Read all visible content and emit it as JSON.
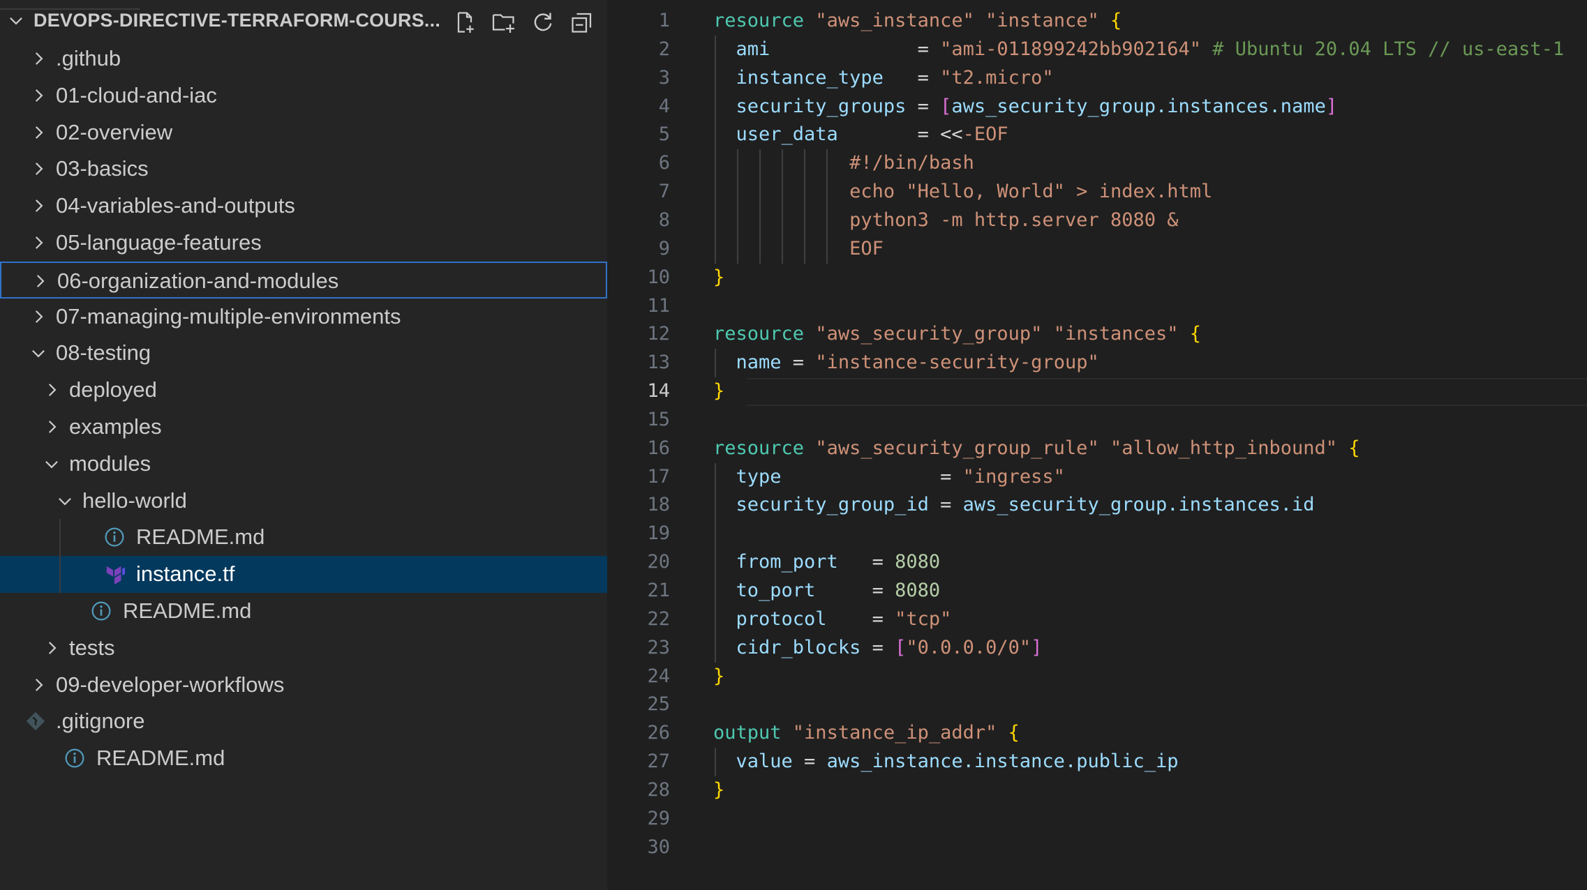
{
  "explorer": {
    "title": "DEVOPS-DIRECTIVE-TERRAFORM-COURS...",
    "actions": [
      {
        "name": "new-file",
        "icon": "new-file-icon"
      },
      {
        "name": "new-folder",
        "icon": "new-folder-icon"
      },
      {
        "name": "refresh",
        "icon": "refresh-icon"
      },
      {
        "name": "collapse-all",
        "icon": "collapse-all-icon"
      }
    ],
    "items": [
      {
        "label": ".github",
        "depth": 0,
        "kind": "folder",
        "expanded": false
      },
      {
        "label": "01-cloud-and-iac",
        "depth": 0,
        "kind": "folder",
        "expanded": false
      },
      {
        "label": "02-overview",
        "depth": 0,
        "kind": "folder",
        "expanded": false
      },
      {
        "label": "03-basics",
        "depth": 0,
        "kind": "folder",
        "expanded": false
      },
      {
        "label": "04-variables-and-outputs",
        "depth": 0,
        "kind": "folder",
        "expanded": false
      },
      {
        "label": "05-language-features",
        "depth": 0,
        "kind": "folder",
        "expanded": false
      },
      {
        "label": "06-organization-and-modules",
        "depth": 0,
        "kind": "folder",
        "expanded": false,
        "state": "focused"
      },
      {
        "label": "07-managing-multiple-environments",
        "depth": 0,
        "kind": "folder",
        "expanded": false
      },
      {
        "label": "08-testing",
        "depth": 0,
        "kind": "folder",
        "expanded": true
      },
      {
        "label": "deployed",
        "depth": 1,
        "kind": "folder",
        "expanded": false
      },
      {
        "label": "examples",
        "depth": 1,
        "kind": "folder",
        "expanded": false
      },
      {
        "label": "modules",
        "depth": 1,
        "kind": "folder",
        "expanded": true
      },
      {
        "label": "hello-world",
        "depth": 2,
        "kind": "folder",
        "expanded": true
      },
      {
        "label": "README.md",
        "depth": 3,
        "kind": "info-file"
      },
      {
        "label": "instance.tf",
        "depth": 3,
        "kind": "terraform-file",
        "state": "selected"
      },
      {
        "label": "README.md",
        "depth": 2,
        "kind": "info-file"
      },
      {
        "label": "tests",
        "depth": 1,
        "kind": "folder",
        "expanded": false
      },
      {
        "label": "09-developer-workflows",
        "depth": 0,
        "kind": "folder",
        "expanded": false
      },
      {
        "label": ".gitignore",
        "depth": 0,
        "kind": "git-file"
      },
      {
        "label": "README.md",
        "depth": 0,
        "kind": "info-file"
      }
    ]
  },
  "editor": {
    "active_line": 14,
    "lines": [
      [
        [
          "kw",
          "resource "
        ],
        [
          "str",
          "\"aws_instance\" "
        ],
        [
          "str",
          "\"instance\" "
        ],
        [
          "brace",
          "{"
        ]
      ],
      [
        [
          "op",
          "  "
        ],
        [
          "attr",
          "ami"
        ],
        [
          "op",
          "             = "
        ],
        [
          "str",
          "\"ami-011899242bb902164\""
        ],
        [
          "com",
          " # Ubuntu 20.04 LTS // us-east-1"
        ]
      ],
      [
        [
          "op",
          "  "
        ],
        [
          "attr",
          "instance_type"
        ],
        [
          "op",
          "   = "
        ],
        [
          "str",
          "\"t2.micro\""
        ]
      ],
      [
        [
          "op",
          "  "
        ],
        [
          "attr",
          "security_groups"
        ],
        [
          "op",
          " = "
        ],
        [
          "bracket",
          "["
        ],
        [
          "attr",
          "aws_security_group.instances.name"
        ],
        [
          "bracket",
          "]"
        ]
      ],
      [
        [
          "op",
          "  "
        ],
        [
          "attr",
          "user_data"
        ],
        [
          "op",
          "       = <<"
        ],
        [
          "heredoc",
          "-EOF"
        ]
      ],
      [
        [
          "op",
          "            "
        ],
        [
          "heredoc",
          "#!/bin/bash"
        ]
      ],
      [
        [
          "op",
          "            "
        ],
        [
          "heredoc",
          "echo \"Hello, World\" > index.html"
        ]
      ],
      [
        [
          "op",
          "            "
        ],
        [
          "heredoc",
          "python3 -m http.server 8080 &"
        ]
      ],
      [
        [
          "op",
          "            "
        ],
        [
          "heredoc",
          "EOF"
        ]
      ],
      [
        [
          "brace",
          "}"
        ]
      ],
      [],
      [
        [
          "kw",
          "resource "
        ],
        [
          "str",
          "\"aws_security_group\" "
        ],
        [
          "str",
          "\"instances\" "
        ],
        [
          "brace",
          "{"
        ]
      ],
      [
        [
          "op",
          "  "
        ],
        [
          "attr",
          "name"
        ],
        [
          "op",
          " = "
        ],
        [
          "str",
          "\"instance-security-group\""
        ]
      ],
      [
        [
          "brace",
          "}"
        ]
      ],
      [],
      [
        [
          "kw",
          "resource "
        ],
        [
          "str",
          "\"aws_security_group_rule\" "
        ],
        [
          "str",
          "\"allow_http_inbound\" "
        ],
        [
          "brace",
          "{"
        ]
      ],
      [
        [
          "op",
          "  "
        ],
        [
          "attr",
          "type"
        ],
        [
          "op",
          "              = "
        ],
        [
          "str",
          "\"ingress\""
        ]
      ],
      [
        [
          "op",
          "  "
        ],
        [
          "attr",
          "security_group_id"
        ],
        [
          "op",
          " = "
        ],
        [
          "attr",
          "aws_security_group.instances.id"
        ]
      ],
      [],
      [
        [
          "op",
          "  "
        ],
        [
          "attr",
          "from_port"
        ],
        [
          "op",
          "   = "
        ],
        [
          "num",
          "8080"
        ]
      ],
      [
        [
          "op",
          "  "
        ],
        [
          "attr",
          "to_port"
        ],
        [
          "op",
          "     = "
        ],
        [
          "num",
          "8080"
        ]
      ],
      [
        [
          "op",
          "  "
        ],
        [
          "attr",
          "protocol"
        ],
        [
          "op",
          "    = "
        ],
        [
          "str",
          "\"tcp\""
        ]
      ],
      [
        [
          "op",
          "  "
        ],
        [
          "attr",
          "cidr_blocks"
        ],
        [
          "op",
          " = "
        ],
        [
          "bracket",
          "["
        ],
        [
          "str",
          "\"0.0.0.0/0\""
        ],
        [
          "bracket",
          "]"
        ]
      ],
      [
        [
          "brace",
          "}"
        ]
      ],
      [],
      [
        [
          "kw",
          "output "
        ],
        [
          "str",
          "\"instance_ip_addr\" "
        ],
        [
          "brace",
          "{"
        ]
      ],
      [
        [
          "op",
          "  "
        ],
        [
          "attr",
          "value"
        ],
        [
          "op",
          " = "
        ],
        [
          "attr",
          "aws_instance.instance.public_ip"
        ]
      ],
      [
        [
          "brace",
          "}"
        ]
      ],
      [],
      []
    ]
  },
  "colors": {
    "sidebar_bg": "#252526",
    "editor_bg": "#1f1f1f",
    "selection": "#04395e",
    "focus_border": "#2f73c9",
    "terraform_purple": "#7b42bc",
    "info_blue": "#519aba"
  }
}
